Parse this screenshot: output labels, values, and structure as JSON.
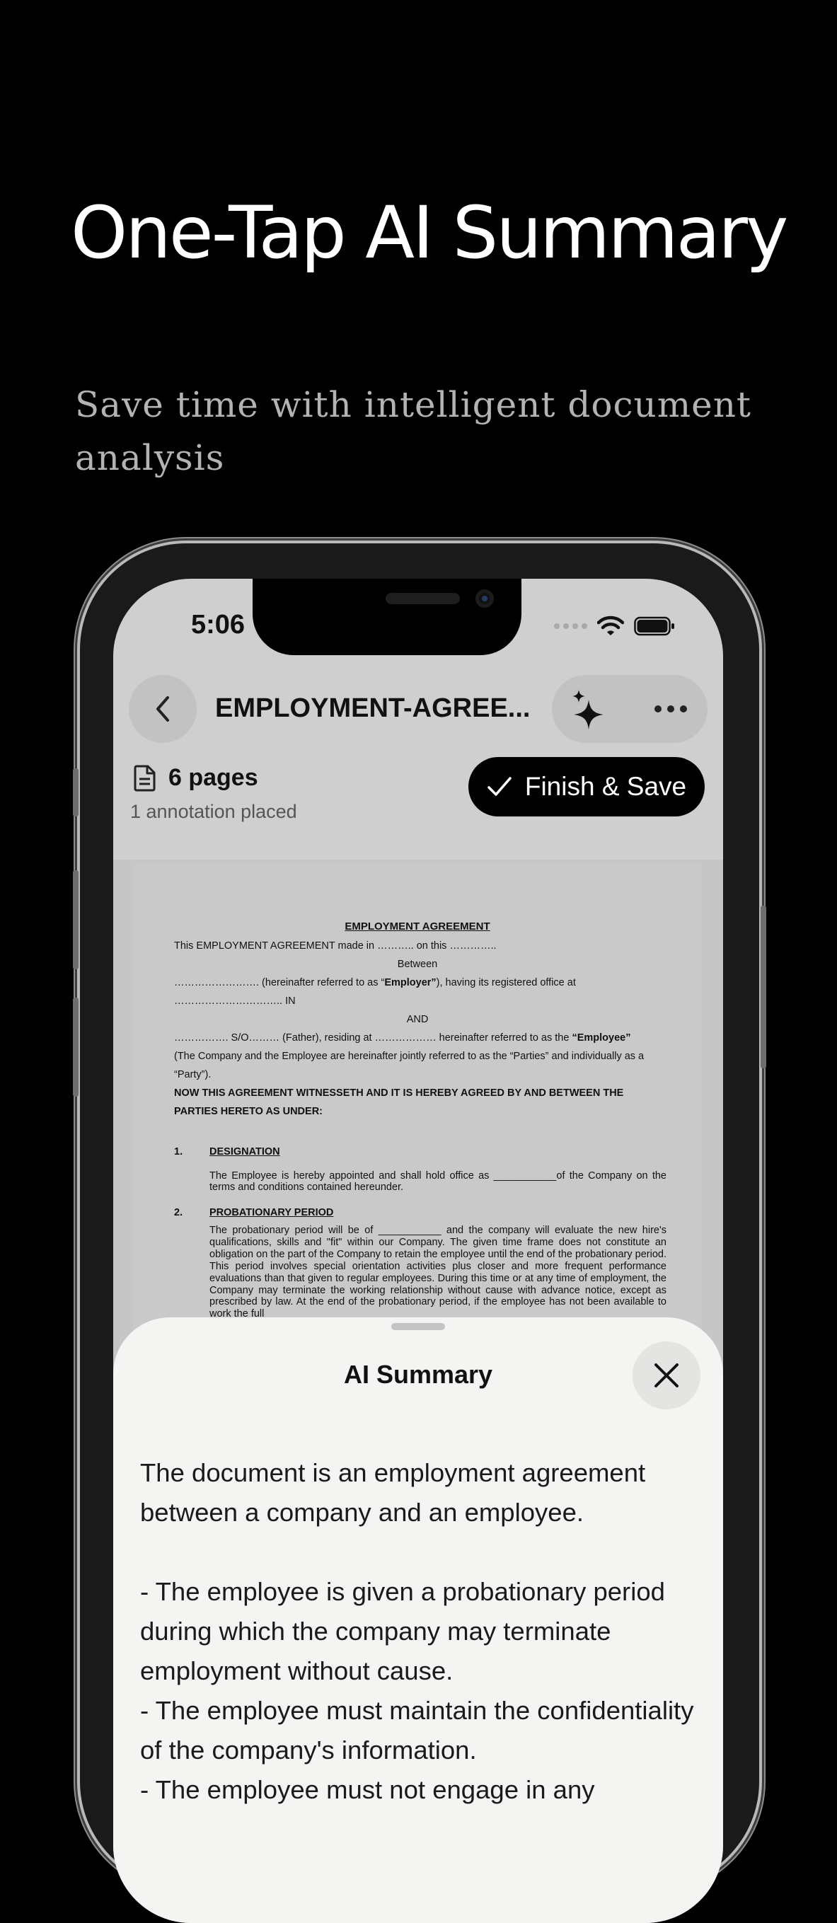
{
  "hero": {
    "title": "One-Tap AI Summary",
    "subtitle": "Save time with intelligent document analysis"
  },
  "status_bar": {
    "time": "5:06"
  },
  "toolbar": {
    "document_title": "EMPLOYMENT-AGREE...",
    "back_icon": "chevron-left-icon",
    "ai_icon": "sparkles-icon",
    "more_icon": "ellipsis-icon"
  },
  "doc_info": {
    "pages": "6 pages",
    "annotations": "1 annotation placed",
    "finish_label": "Finish & Save"
  },
  "document": {
    "heading": "EMPLOYMENT AGREEMENT",
    "line1": "This EMPLOYMENT AGREEMENT made in ……….. on this …………..",
    "between": "Between",
    "line2a": "……………………. (hereinafter referred to as “",
    "line2b": "Employer”",
    "line2c": "), having its registered office at",
    "line3": "………………………….. IN",
    "and": "AND",
    "line4a": "……………. S/O……… (Father), residing at ……………… hereinafter referred to as the ",
    "line4b": "“Employee”",
    "line5": "(The Company and the Employee are hereinafter jointly referred to as the “Parties” and individually as a",
    "line6": "“Party”).",
    "witness1": "NOW THIS AGREEMENT WITNESSETH AND IT IS HEREBY AGREED BY AND BETWEEN THE",
    "witness2": "PARTIES HERETO AS UNDER:",
    "s1_num": "1.",
    "s1_title": "DESIGNATION",
    "s1_body": "The Employee is hereby appointed and shall hold  office as ___________of the Company on the terms and conditions contained hereunder.",
    "s2_num": "2.",
    "s2_title": "PROBATIONARY PERIOD",
    "s2_body": "The probationary period will be of ___________ and the company will evaluate the new hire's qualifications, skills and \"fit\" within our Company. The given time frame does not constitute an obligation on the part of the Company to retain the employee until the end of the probationary period. This period involves special orientation activities plus closer and more frequent performance evaluations than that given to regular employees. During this time or at any time of employment, the Company may terminate the working relationship without cause with advance notice, except as prescribed by law. At the end of the probationary period, if the employee has not been available to work the full"
  },
  "summary_sheet": {
    "title": "AI Summary",
    "close_icon": "close-icon",
    "text": "The document is an employment agreement between a company and an employee.\n\n- The employee is given a probationary period during which the company may terminate employment without cause.\n- The employee must maintain the confidentiality of the company's information.\n- The employee must not engage in any"
  }
}
